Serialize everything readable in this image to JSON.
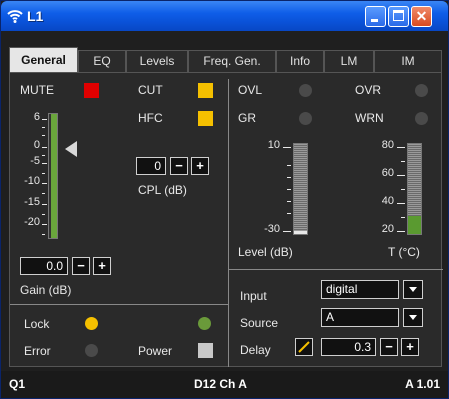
{
  "window": {
    "title": "L1",
    "icon": "wifi-signal-icon",
    "minimize": "minimize-icon",
    "maximize": "maximize-icon",
    "close": "close-icon",
    "close_glyph": "✕"
  },
  "tabs": [
    "General",
    "EQ",
    "Levels",
    "Freq. Gen.",
    "Info",
    "LM",
    "IM"
  ],
  "active_tab": "General",
  "general": {
    "mute_label": "MUTE",
    "mute_color": "#e00000",
    "cut_label": "CUT",
    "cut_color": "#f5c000",
    "hfc_label": "HFC",
    "hfc_color": "#f5c000",
    "gain_scale": [
      "6",
      "0",
      "-5",
      "-10",
      "-15",
      "-20"
    ],
    "gain_value": "0.0",
    "gain_label": "Gain (dB)",
    "cpl_value": "0",
    "cpl_label": "CPL (dB)",
    "minus": "−",
    "plus": "+",
    "ovl_label": "OVL",
    "ovr_label": "OVR",
    "gr_label": "GR",
    "wrn_label": "WRN",
    "level_scale": [
      "10",
      "-30"
    ],
    "level_label": "Level (dB)",
    "temp_scale": [
      "80",
      "60",
      "40",
      "20"
    ],
    "temp_label": "T (°C)",
    "temp_fill_color": "#5a9a30",
    "input_label": "Input",
    "input_value": "digital",
    "source_label": "Source",
    "source_value": "A",
    "delay_label": "Delay",
    "delay_value": "0.3",
    "lock_label": "Lock",
    "lock_led_color": "#f5c000",
    "error_label": "Error",
    "power_label": "Power",
    "power_led_color": "#6a9a3a",
    "power_sq_color": "#c8c8c8"
  },
  "status": {
    "left": "Q1",
    "center": "D12 Ch A",
    "right": "A 1.01"
  }
}
